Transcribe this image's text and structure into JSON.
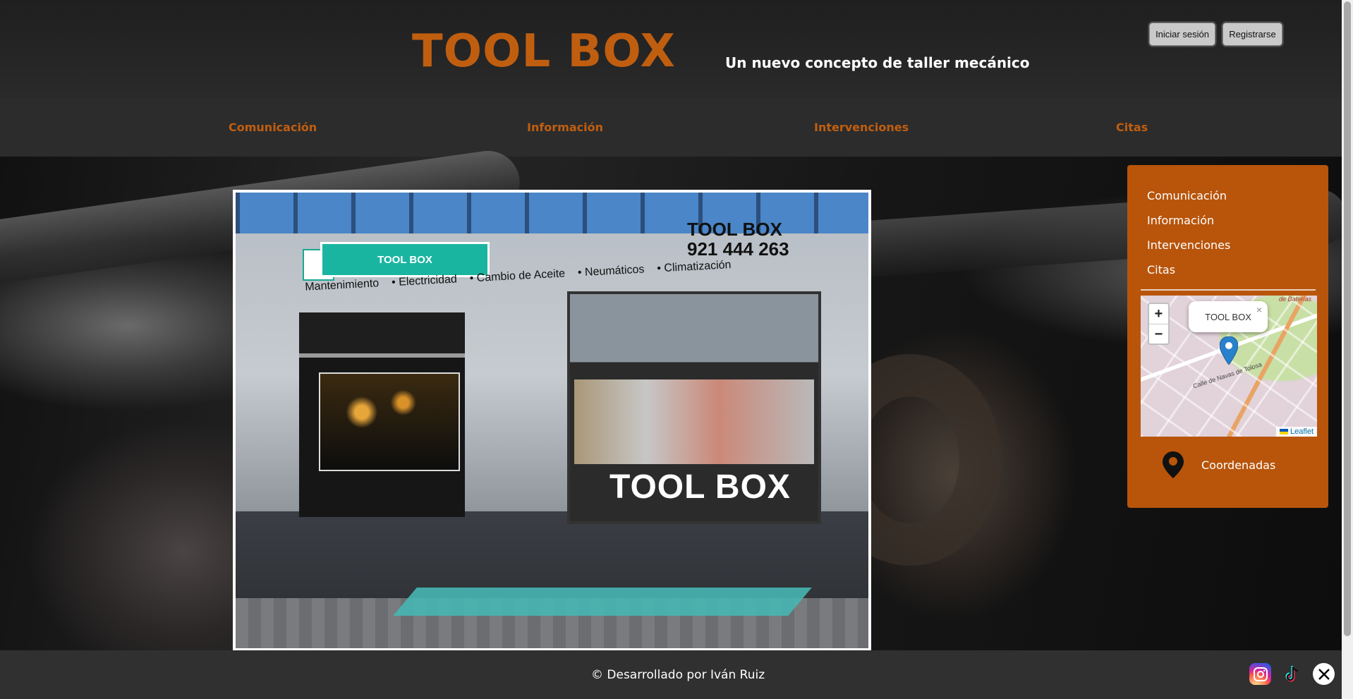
{
  "header": {
    "title": "TOOL BOX",
    "tagline": "Un nuevo concepto de taller mecánico",
    "login_label": "Iniciar sesión",
    "register_label": "Registrarse"
  },
  "nav": {
    "items": [
      {
        "label": "Comunicación"
      },
      {
        "label": "Información"
      },
      {
        "label": "Intervenciones"
      },
      {
        "label": "Citas"
      }
    ]
  },
  "side_panel": {
    "links": [
      {
        "label": "Comunicación"
      },
      {
        "label": "Información"
      },
      {
        "label": "Intervenciones"
      },
      {
        "label": "Citas"
      }
    ],
    "map": {
      "popup_label": "TOOL BOX",
      "zoom_in": "+",
      "zoom_out": "−",
      "close": "×",
      "attribution": "Leaflet",
      "streets": [
        "de Baterías",
        "Calle de Navas de Tolosa"
      ]
    },
    "coords_label": "Coordenadas"
  },
  "photo": {
    "sign_text": "TOOL BOX",
    "phone_title": "TOOL BOX",
    "phone_number": "921 444 263",
    "services": [
      "Mantenimiento",
      "Electricidad",
      "Cambio de Aceite",
      "Neumáticos",
      "Climatización"
    ],
    "window_brand": "TOOL BOX"
  },
  "footer": {
    "credit": "© Desarrollado por Iván Ruiz",
    "social": [
      "instagram-icon",
      "tiktok-icon",
      "x-icon"
    ]
  },
  "colors": {
    "brand_orange": "#c05e10",
    "panel_orange": "#b8550b",
    "header_bg": "#222222",
    "nav_bg": "#2c2c2c",
    "footer_bg": "#303030"
  }
}
